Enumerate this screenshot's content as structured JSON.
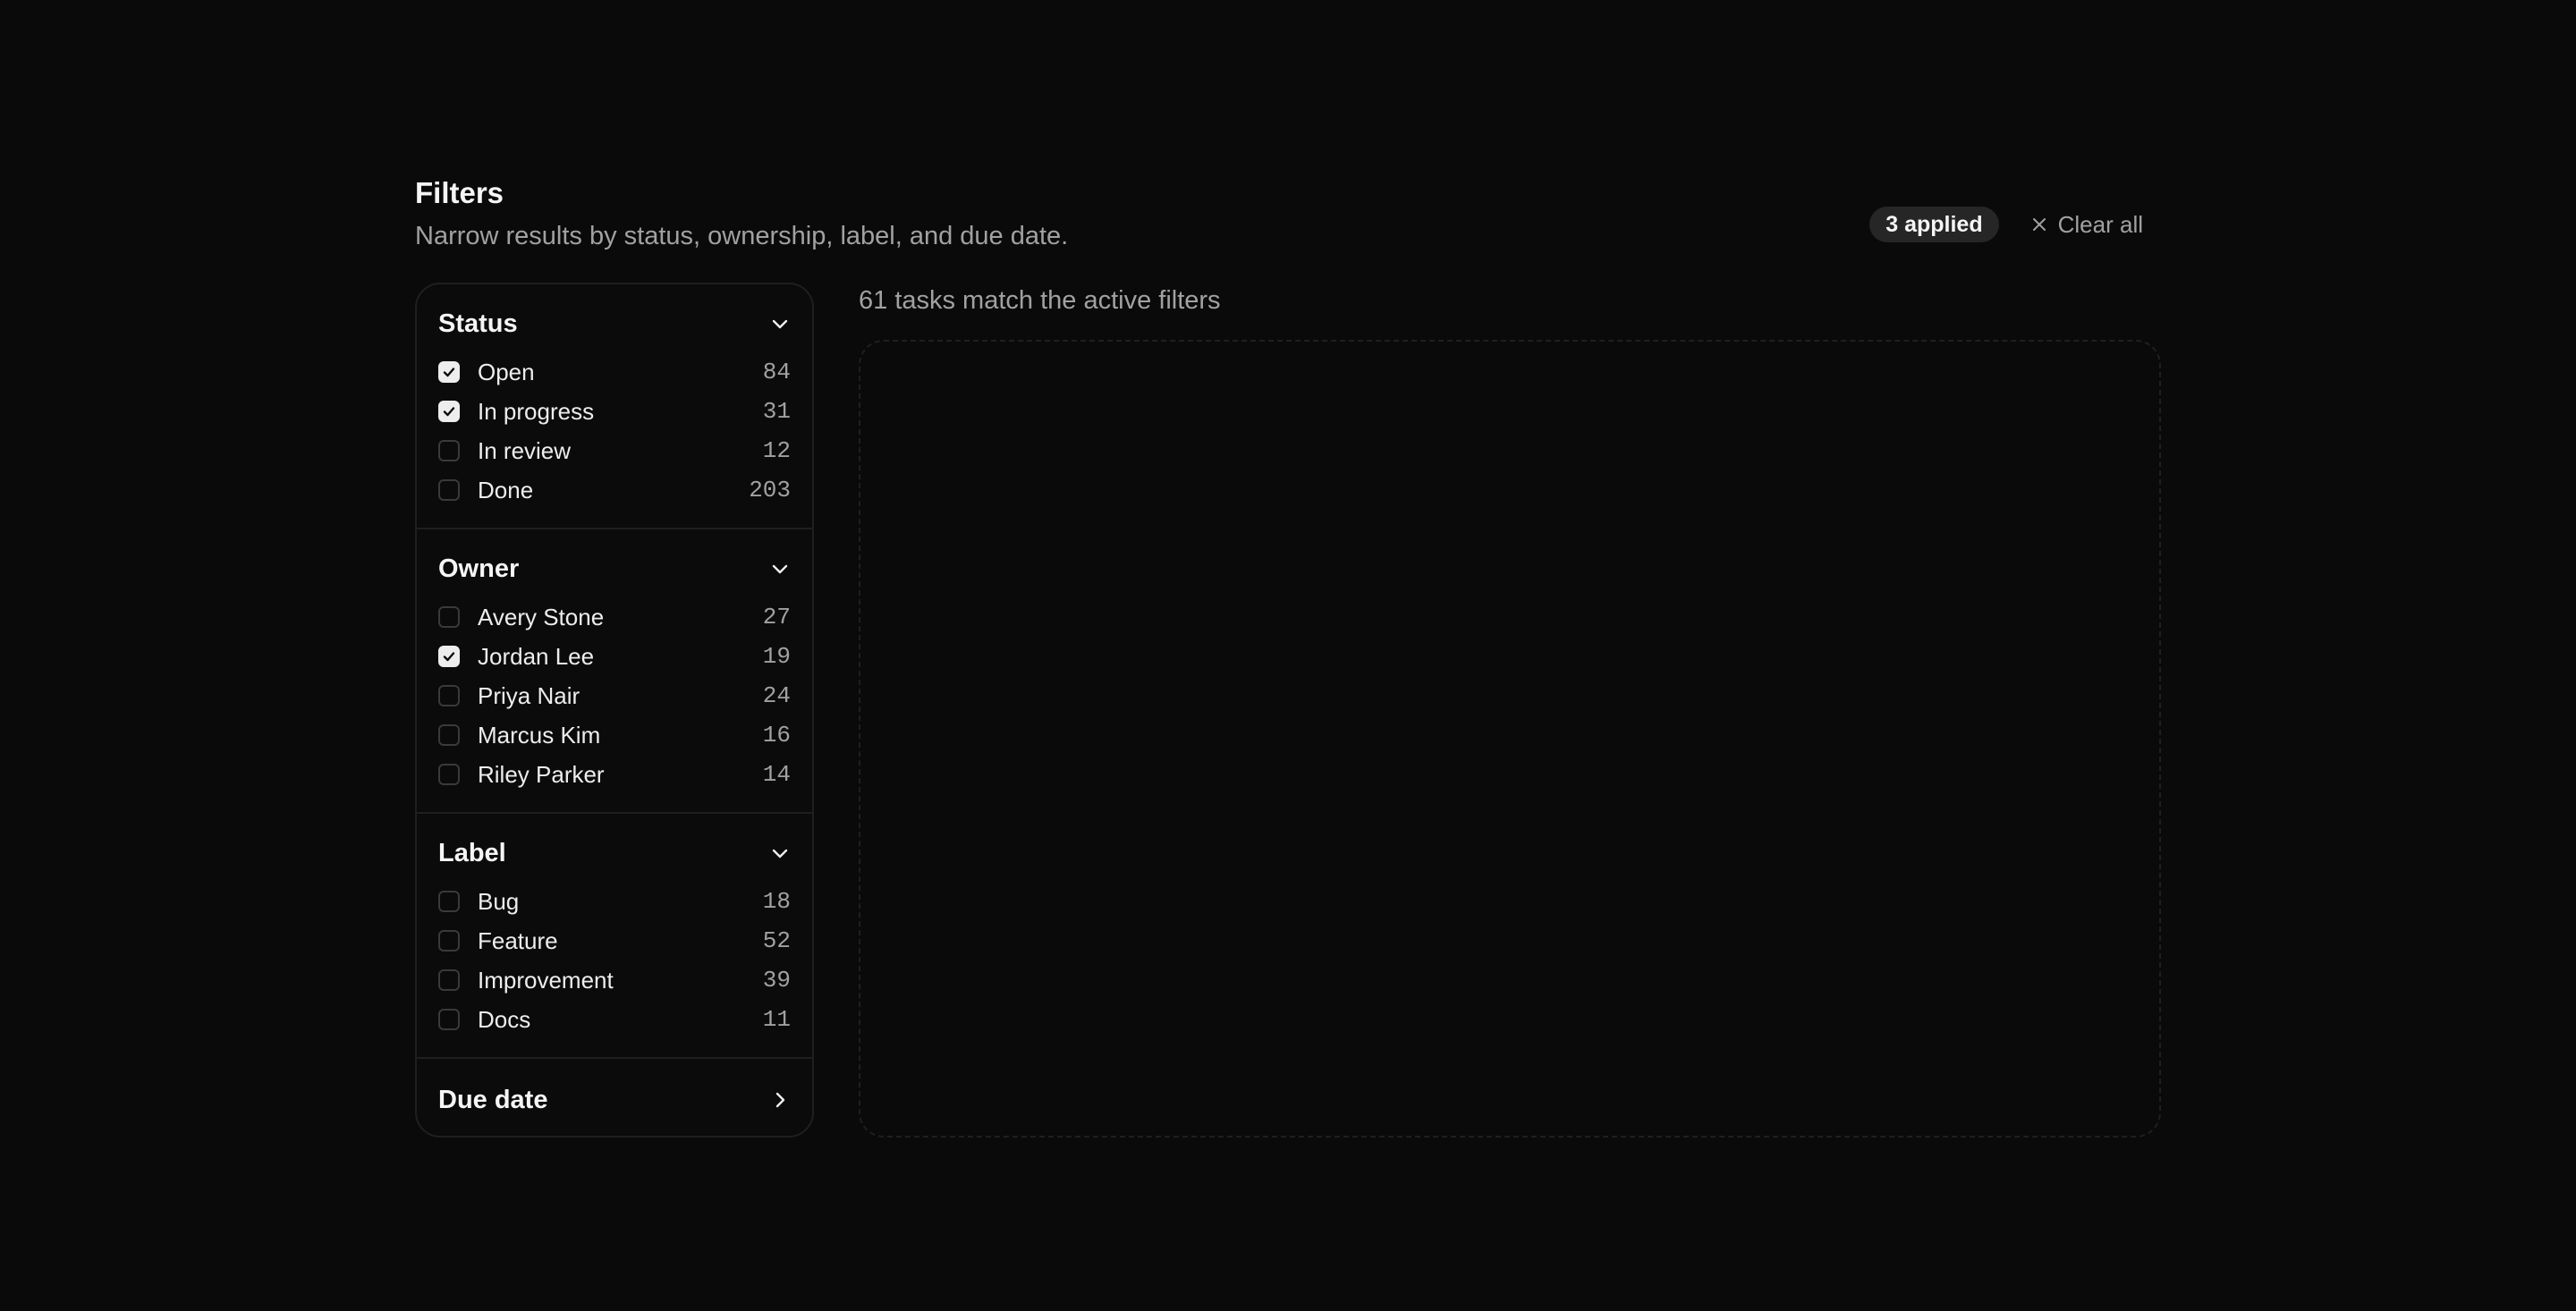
{
  "header": {
    "title": "Filters",
    "subtitle": "Narrow results by status, ownership, label, and due date.",
    "applied_badge": "3 applied",
    "clear_all_label": "Clear all"
  },
  "sections": [
    {
      "title": "Status",
      "expanded": true,
      "options": [
        {
          "label": "Open",
          "count": "84",
          "checked": true
        },
        {
          "label": "In progress",
          "count": "31",
          "checked": true
        },
        {
          "label": "In review",
          "count": "12",
          "checked": false
        },
        {
          "label": "Done",
          "count": "203",
          "checked": false
        }
      ]
    },
    {
      "title": "Owner",
      "expanded": true,
      "options": [
        {
          "label": "Avery Stone",
          "count": "27",
          "checked": false
        },
        {
          "label": "Jordan Lee",
          "count": "19",
          "checked": true
        },
        {
          "label": "Priya Nair",
          "count": "24",
          "checked": false
        },
        {
          "label": "Marcus Kim",
          "count": "16",
          "checked": false
        },
        {
          "label": "Riley Parker",
          "count": "14",
          "checked": false
        }
      ]
    },
    {
      "title": "Label",
      "expanded": true,
      "options": [
        {
          "label": "Bug",
          "count": "18",
          "checked": false
        },
        {
          "label": "Feature",
          "count": "52",
          "checked": false
        },
        {
          "label": "Improvement",
          "count": "39",
          "checked": false
        },
        {
          "label": "Docs",
          "count": "11",
          "checked": false
        }
      ]
    },
    {
      "title": "Due date",
      "expanded": false,
      "options": []
    }
  ],
  "results": {
    "summary": "61 tasks match the active filters"
  },
  "icons": {
    "expanded_section": "chevron-down-icon",
    "collapsed_section": "chevron-right-icon",
    "clear": "close-icon",
    "checked": "check-icon"
  },
  "colors": {
    "background": "#0a0a0a",
    "border": "#1f1f1f",
    "text": "#ededed",
    "muted": "#a1a1a1",
    "badge_bg": "#262626"
  }
}
